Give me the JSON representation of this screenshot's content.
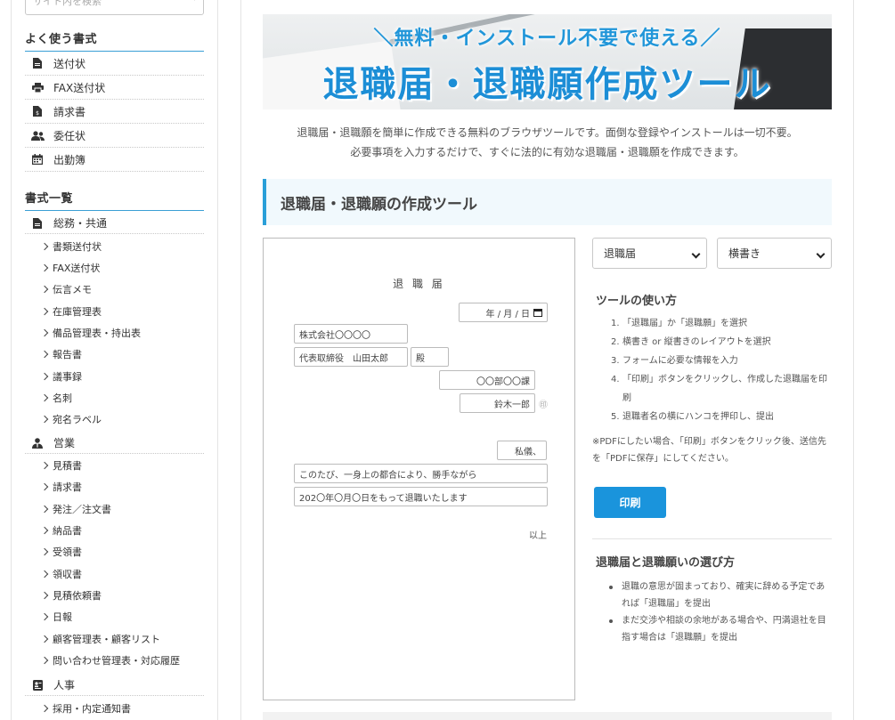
{
  "sidebar": {
    "search_placeholder": "サイト内を検索",
    "frequent": {
      "heading": "よく使う書式",
      "items": [
        {
          "label": "送付状",
          "icon": "file-icon"
        },
        {
          "label": "FAX送付状",
          "icon": "printer-icon"
        },
        {
          "label": "請求書",
          "icon": "invoice-icon"
        },
        {
          "label": "委任状",
          "icon": "users-icon"
        },
        {
          "label": "出勤簿",
          "icon": "calendar-icon"
        }
      ]
    },
    "catalog": {
      "heading": "書式一覧",
      "categories": [
        {
          "label": "総務・共通",
          "icon": "file-icon",
          "items": [
            "書類送付状",
            "FAX送付状",
            "伝言メモ",
            "在庫管理表",
            "備品管理表・持出表",
            "報告書",
            "議事録",
            "名刺",
            "宛名ラベル"
          ]
        },
        {
          "label": "営業",
          "icon": "user-tie-icon",
          "items": [
            "見積書",
            "請求書",
            "発注／注文書",
            "納品書",
            "受領書",
            "領収書",
            "見積依頼書",
            "日報",
            "顧客管理表・顧客リスト",
            "問い合わせ管理表・対応履歴"
          ]
        },
        {
          "label": "人事",
          "icon": "id-card-icon",
          "items": [
            "採用・内定通知書"
          ]
        }
      ]
    }
  },
  "banner": {
    "subtitle": "＼無料・インストール不要で使える／",
    "title": "退職届・退職願作成ツール"
  },
  "intro": {
    "line1": "退職届・退職願を簡単に作成できる無料のブラウザツールです。面倒な登録やインストールは一切不要。",
    "line2": "必要事項を入力するだけで、すぐに法的に有効な退職届・退職願を作成できます。"
  },
  "section_title": "退職届・退職願の作成ツール",
  "letter": {
    "title": "退 職 届",
    "date_placeholder": "年 / 月 / 日",
    "company": "株式会社〇〇〇〇",
    "ceo": "代表取締役　山田太郎",
    "honorific": "殿",
    "department": "〇〇部〇〇課",
    "name": "鈴木一郎",
    "seal": "㊞",
    "watakushi": "私儀、",
    "body1": "このたび、一身上の都合により、勝手ながら",
    "body2": "202〇年〇月〇日をもって退職いたします",
    "closing": "以上"
  },
  "controls": {
    "doc_type": "退職届",
    "layout": "横書き"
  },
  "howto": {
    "heading": "ツールの使い方",
    "steps": [
      "「退職届」か「退職願」を選択",
      "横書き or 縦書きのレイアウトを選択",
      "フォームに必要な情報を入力",
      "「印刷」ボタンをクリックし、作成した退職届を印刷",
      "退職者名の横にハンコを押印し、提出"
    ],
    "note": "※PDFにしたい場合、「印刷」ボタンをクリック後、送信先を「PDFに保存」にしてください。",
    "print_label": "印刷"
  },
  "choose": {
    "heading": "退職届と退職願いの選び方",
    "items": [
      "退職の意思が固まっており、確実に辞める予定であれば「退職届」を提出",
      "まだ交渉や相談の余地がある場合や、円満退社を目指す場合は「退職願」を提出"
    ]
  },
  "colors": {
    "accent": "#1a94dc",
    "heading_bg": "#f1f9fd"
  }
}
